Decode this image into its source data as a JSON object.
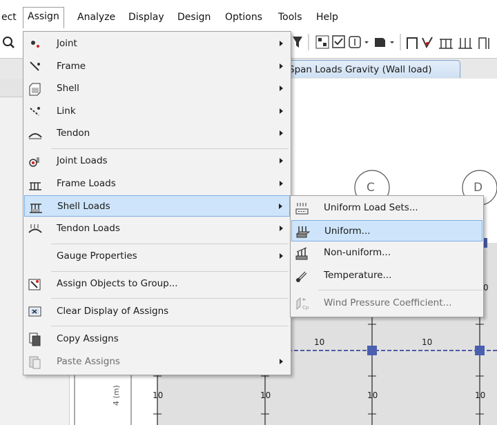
{
  "menubar": {
    "items": [
      {
        "label": "ect"
      },
      {
        "label": "Assign"
      },
      {
        "label": "Analyze"
      },
      {
        "label": "Display"
      },
      {
        "label": "Design"
      },
      {
        "label": "Options"
      },
      {
        "label": "Tools"
      },
      {
        "label": "Help"
      }
    ]
  },
  "view_tab": {
    "label": "Span Loads Gravity (Wall load)"
  },
  "assign_menu": {
    "items": [
      {
        "label": "Joint",
        "icon": "joint-icon"
      },
      {
        "label": "Frame",
        "icon": "frame-icon"
      },
      {
        "label": "Shell",
        "icon": "shell-icon"
      },
      {
        "label": "Link",
        "icon": "link-icon"
      },
      {
        "label": "Tendon",
        "icon": "tendon-icon"
      },
      {
        "label": "Joint Loads",
        "icon": "joint-loads-icon"
      },
      {
        "label": "Frame Loads",
        "icon": "frame-loads-icon"
      },
      {
        "label": "Shell Loads",
        "icon": "shell-loads-icon"
      },
      {
        "label": "Tendon Loads",
        "icon": "tendon-loads-icon"
      },
      {
        "label": "Gauge Properties",
        "icon": ""
      },
      {
        "label": "Assign Objects to Group...",
        "icon": "group-icon"
      },
      {
        "label": "Clear Display of Assigns",
        "icon": "clear-display-icon"
      },
      {
        "label": "Copy Assigns",
        "icon": "copy-icon"
      },
      {
        "label": "Paste Assigns",
        "icon": "paste-icon"
      }
    ]
  },
  "shell_loads_submenu": {
    "items": [
      {
        "label": "Uniform Load Sets...",
        "icon": "uniform-load-sets-icon"
      },
      {
        "label": "Uniform...",
        "icon": "uniform-load-icon"
      },
      {
        "label": "Non-uniform...",
        "icon": "non-uniform-load-icon"
      },
      {
        "label": "Temperature...",
        "icon": "temperature-icon"
      },
      {
        "label": "Wind Pressure Coefficient...",
        "icon": "wind-pressure-icon"
      }
    ]
  },
  "plan": {
    "grid_bubbles": [
      "C",
      "D"
    ],
    "span_labels": [
      "10",
      "10"
    ],
    "frame_labels": [
      "10",
      "10",
      "10",
      "10"
    ],
    "dimension_label": "4 (m)",
    "edge_label": "0"
  },
  "colors": {
    "highlight": "#cde4fa",
    "highlight_border": "#7fb0e3",
    "menu_bg": "#f2f2f2",
    "node_blue": "#4a5fb0"
  }
}
